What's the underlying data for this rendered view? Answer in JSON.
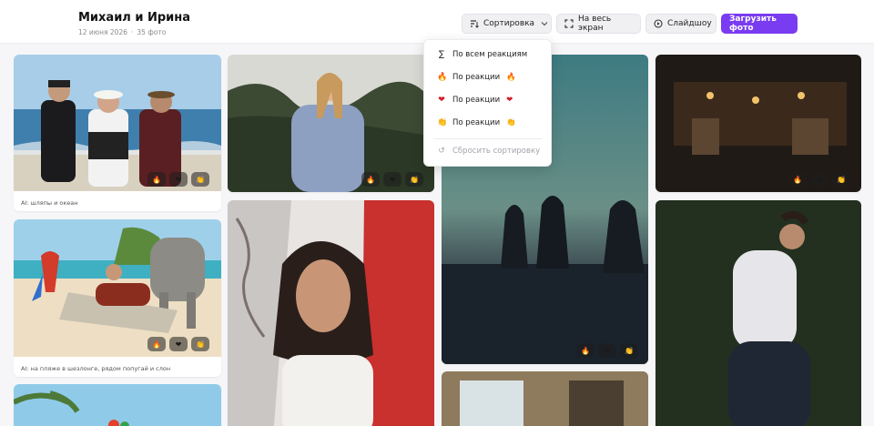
{
  "header": {
    "title": "Михаил и Ирина",
    "date": "12 июня 2026",
    "photo_count": "35 фото",
    "buttons": {
      "sort": "Сортировка",
      "fullscreen": "На весь экран",
      "slideshow": "Слайдшоу",
      "upload": "Загрузить фото"
    }
  },
  "sort_menu": {
    "items": [
      {
        "icon": "sigma-icon",
        "label": "По всем реакциям"
      },
      {
        "icon": "fire-icon",
        "label": "По реакции",
        "emoji": "🔥"
      },
      {
        "icon": "heart-icon",
        "label": "По реакции",
        "emoji": "❤"
      },
      {
        "icon": "clap-icon",
        "label": "По реакции",
        "emoji": "👏"
      }
    ],
    "reset": "Сбросить сортировку"
  },
  "cards": [
    {
      "caption": "AI: шляпы и океан"
    },
    {
      "caption": "AI: на пляже в шезлонге, рядом попугай и слон"
    }
  ],
  "reactions": {
    "fire": "🔥",
    "heart": "❤",
    "clap": "👏"
  },
  "colors": {
    "accent": "#7a3cf0"
  }
}
